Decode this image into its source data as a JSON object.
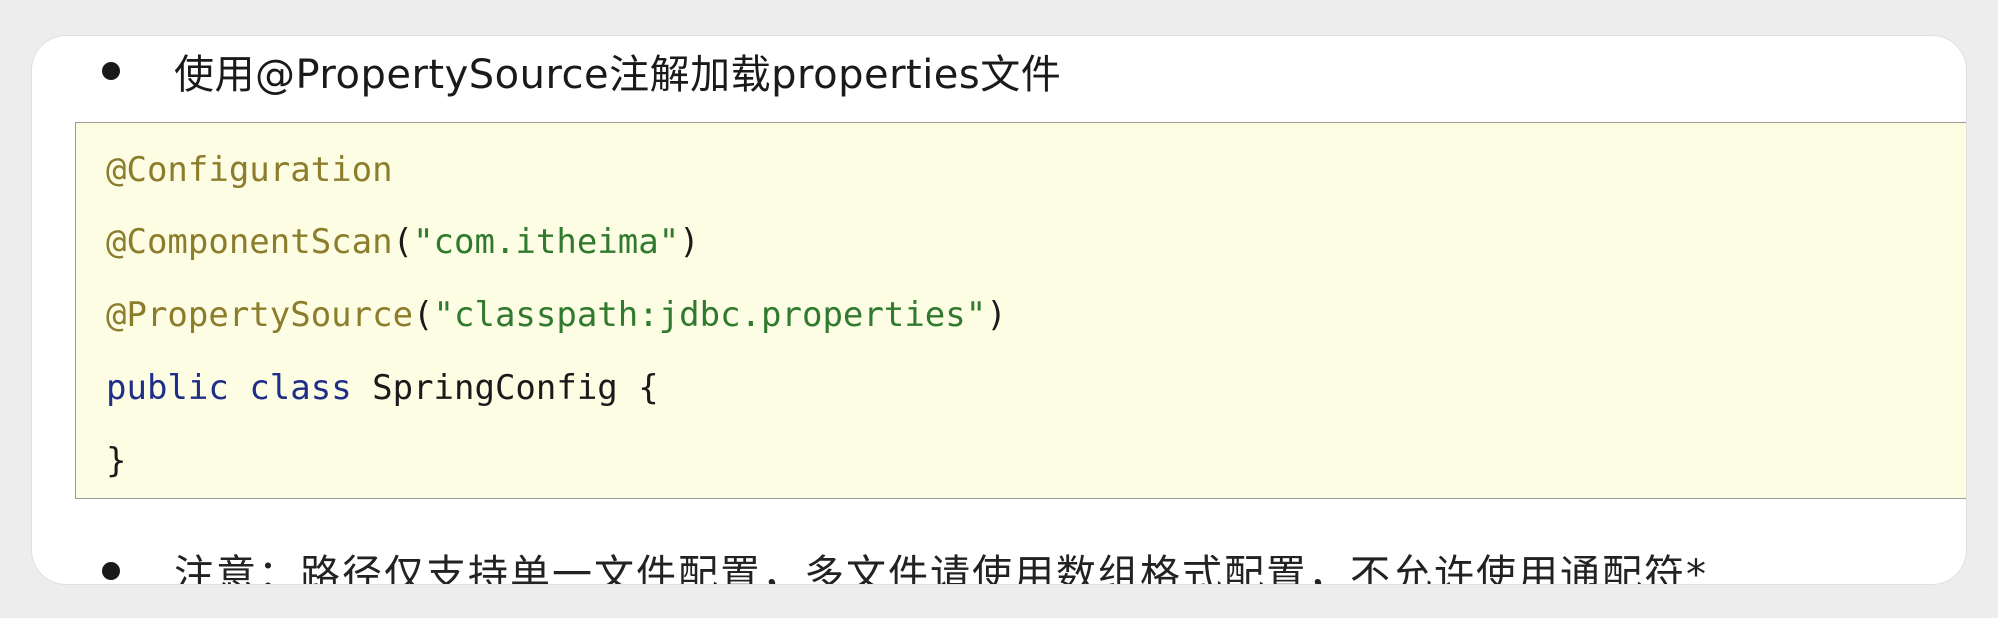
{
  "bullets": {
    "first": "使用@PropertySource注解加载properties文件",
    "second": "注意：路径仅支持单一文件配置，多文件请使用数组格式配置，不允许使用通配符*"
  },
  "code": {
    "line1": {
      "annotation": "@Configuration"
    },
    "line2": {
      "annotation": "@ComponentScan",
      "open": "(",
      "string": "\"com.itheima\"",
      "close": ")"
    },
    "line3": {
      "annotation": "@PropertySource",
      "open": "(",
      "string": "\"classpath:jdbc.properties\"",
      "close": ")"
    },
    "line4": {
      "kw1": "public",
      "space1": " ",
      "kw2": "class",
      "rest": " SpringConfig {"
    },
    "line5": {
      "text": "}"
    }
  },
  "colors": {
    "annotation": "#8b7d2c",
    "string": "#2f7a2f",
    "keyword": "#1f2f87",
    "code_background": "#fdfde4"
  }
}
